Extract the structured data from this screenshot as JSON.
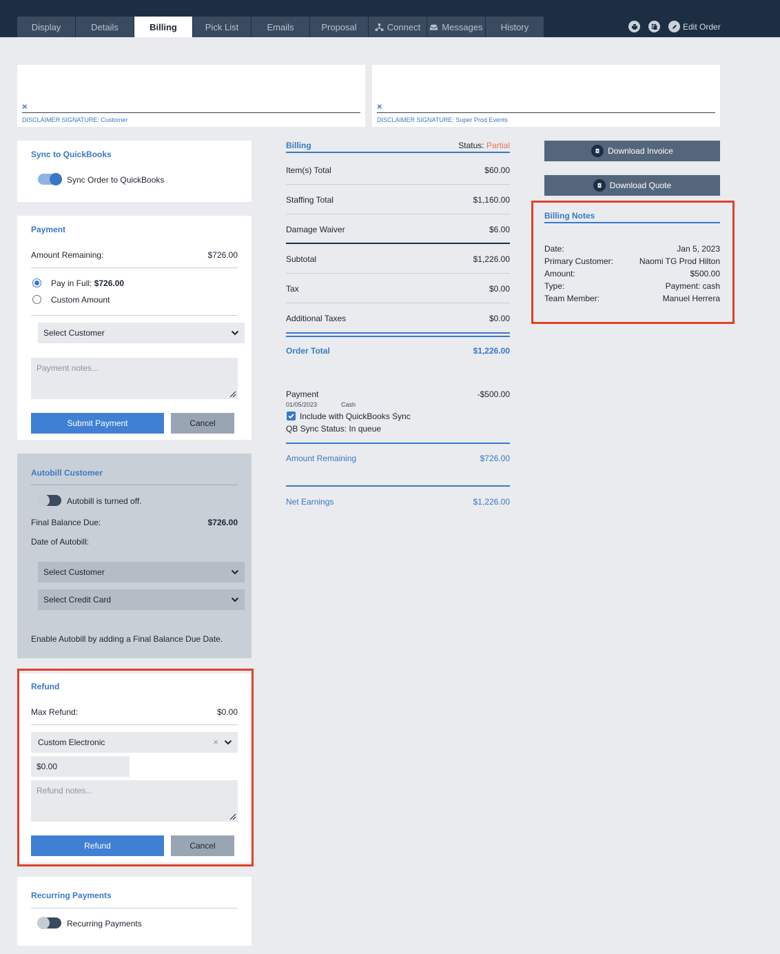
{
  "nav": {
    "tabs": [
      "Display",
      "Details",
      "Billing",
      "Pick List",
      "Emails",
      "Proposal",
      "Connect",
      "Messages",
      "History"
    ],
    "active_tab": "Billing",
    "edit_order": "Edit Order"
  },
  "signatures": {
    "x_mark": "×",
    "customer": "DISCLAIMER SIGNATURE: Customer",
    "company": "DISCLAIMER SIGNATURE: Super Prod Events"
  },
  "quickbooks": {
    "title": "Sync to QuickBooks",
    "toggle_label": "Sync Order to QuickBooks"
  },
  "payment": {
    "title": "Payment",
    "remaining_label": "Amount Remaining:",
    "remaining_value": "$726.00",
    "pay_full_label": "Pay in Full: ",
    "pay_full_amount": "$726.00",
    "custom_amount": "Custom Amount",
    "select_customer": "Select Customer",
    "notes_placeholder": "Payment notes...",
    "submit": "Submit Payment",
    "cancel": "Cancel"
  },
  "autobill": {
    "title": "Autobill Customer",
    "toggle_label": "Autobill is turned off.",
    "final_label": "Final Balance Due:",
    "final_value": "$726.00",
    "date_label": "Date of Autobill:",
    "select_customer": "Select Customer",
    "select_card": "Select Credit Card",
    "hint": "Enable Autobill by adding a Final Balance Due Date."
  },
  "refund": {
    "title": "Refund",
    "max_label": "Max Refund:",
    "max_value": "$0.00",
    "method": "Custom Electronic",
    "clear": "×",
    "amount": "$0.00",
    "notes_placeholder": "Refund notes...",
    "submit": "Refund",
    "cancel": "Cancel"
  },
  "recurring": {
    "title": "Recurring Payments",
    "toggle_label": "Recurring Payments"
  },
  "billing": {
    "title": "Billing",
    "status_label": "Status:",
    "status_value": "Partial",
    "rows": [
      {
        "label": "Item(s) Total",
        "value": "$60.00"
      },
      {
        "label": "Staffing Total",
        "value": "$1,160.00"
      },
      {
        "label": "Damage Waiver",
        "value": "$6.00"
      },
      {
        "label": "Subtotal",
        "value": "$1,226.00"
      },
      {
        "label": "Tax",
        "value": "$0.00"
      },
      {
        "label": "Additional Taxes",
        "value": "$0.00"
      }
    ],
    "order_total_label": "Order Total",
    "order_total_value": "$1,226.00",
    "payment": {
      "label": "Payment",
      "value": "-$500.00",
      "date": "01/05/2023",
      "method": "Cash",
      "qb_include": "Include with QuickBooks Sync",
      "qb_status": "QB Sync Status: In queue"
    },
    "remaining_label": "Amount Remaining",
    "remaining_value": "$726.00",
    "net_label": "Net Earnings",
    "net_value": "$1,226.00"
  },
  "downloads": {
    "invoice": "Download Invoice",
    "quote": "Download Quote"
  },
  "billing_notes": {
    "title": "Billing Notes",
    "rows": [
      {
        "label": "Date:",
        "value": "Jan 5, 2023"
      },
      {
        "label": "Primary Customer:",
        "value": "Naomi TG Prod Hilton"
      },
      {
        "label": "Amount:",
        "value": "$500.00"
      },
      {
        "label": "Type:",
        "value": "Payment: cash"
      },
      {
        "label": "Team Member:",
        "value": "Manuel Herrera"
      }
    ]
  },
  "colors": {
    "nav_bg": "#1e2e42",
    "accent": "#3a78c7",
    "status_partial": "#e8735a",
    "highlight": "#e0402a"
  }
}
